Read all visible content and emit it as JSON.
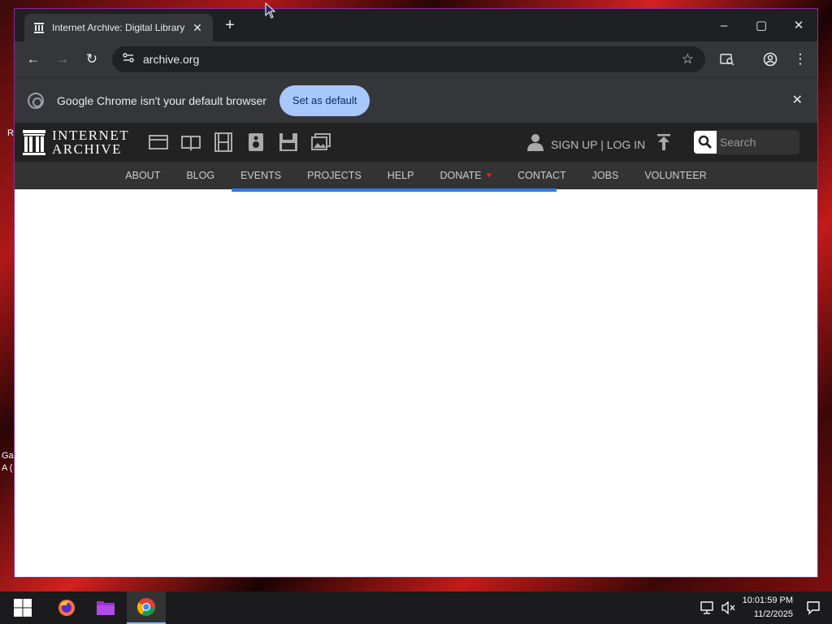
{
  "desktop": {
    "left_labels": [
      "R",
      "Ga",
      "A ("
    ]
  },
  "browser": {
    "tab": {
      "title": "Internet Archive: Digital Library"
    },
    "window_controls": {
      "minimize": "–",
      "maximize": "▢",
      "close": "✕"
    },
    "omnibox": {
      "url": "archive.org"
    },
    "infobar": {
      "message": "Google Chrome isn't your default browser",
      "button": "Set as default"
    }
  },
  "site": {
    "logo": {
      "line1": "INTERNET",
      "line2": "ARCHIVE"
    },
    "media_icons": [
      "web-icon",
      "texts-icon",
      "video-icon",
      "audio-icon",
      "software-icon",
      "images-icon"
    ],
    "account": {
      "label": "SIGN UP | LOG IN"
    },
    "search": {
      "placeholder": "Search"
    },
    "nav": [
      "ABOUT",
      "BLOG",
      "EVENTS",
      "PROJECTS",
      "HELP",
      "DONATE",
      "CONTACT",
      "JOBS",
      "VOLUNTEER"
    ],
    "loading_progress": 0.4
  },
  "taskbar": {
    "clock": {
      "time": "10:01:59 PM",
      "date": "11/2/2025"
    }
  },
  "colors": {
    "accent": "#2b7de9",
    "set_default_bg": "#a8c7fa",
    "donate_heart": "#e2231a"
  }
}
